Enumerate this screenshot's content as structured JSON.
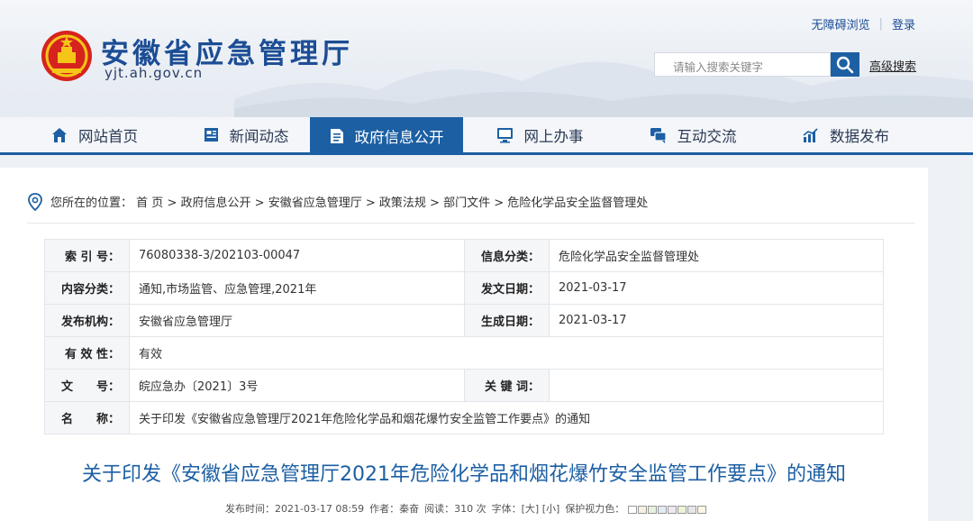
{
  "header": {
    "site_title": "安徽省应急管理厅",
    "site_domain": "yjt.ah.gov.cn",
    "accessibility_link": "无障碍浏览",
    "login_link": "登录",
    "search_placeholder": "请输入搜索关键字",
    "advanced_search": "高级搜索"
  },
  "nav": {
    "items": [
      {
        "label": "网站首页",
        "icon": "home-icon"
      },
      {
        "label": "新闻动态",
        "icon": "news-icon"
      },
      {
        "label": "政府信息公开",
        "icon": "document-icon",
        "active": true
      },
      {
        "label": "网上办事",
        "icon": "monitor-icon"
      },
      {
        "label": "互动交流",
        "icon": "chat-icon"
      },
      {
        "label": "数据发布",
        "icon": "chart-icon"
      }
    ]
  },
  "breadcrumb": {
    "prefix": "您所在的位置：",
    "items": [
      "首 页",
      "政府信息公开",
      "安徽省应急管理厅",
      "政策法规",
      "部门文件",
      "危险化学品安全监督管理处"
    ],
    "separator": ">"
  },
  "meta": {
    "index_label": "索 引 号：",
    "index_value": "76080338-3/202103-00047",
    "category_label": "信息分类：",
    "category_value": "危险化学品安全监督管理处",
    "content_label": "内容分类：",
    "content_value": "通知,市场监管、应急管理,2021年",
    "issue_date_label": "发文日期：",
    "issue_date_value": "2021-03-17",
    "org_label": "发布机构：",
    "org_value": "安徽省应急管理厅",
    "gen_date_label": "生成日期：",
    "gen_date_value": "2021-03-17",
    "validity_label": "有 效 性：",
    "validity_value": "有效",
    "docno_label": "文　　号：",
    "docno_value": "皖应急办〔2021〕3号",
    "keywords_label": "关 键 词：",
    "keywords_value": "",
    "name_label": "名　　称：",
    "name_value": "关于印发《安徽省应急管理厅2021年危险化学品和烟花爆竹安全监管工作要点》的通知"
  },
  "document": {
    "title": "关于印发《安徽省应急管理厅2021年危险化学品和烟花爆竹安全监管工作要点》的通知",
    "publish_time": "发布时间：2021-03-17 08:59",
    "author": "作者：秦奋",
    "views": "阅读：310 次",
    "font_size_label": "字体：",
    "font_large": "[大]",
    "font_small": "[小]",
    "eye_care_label": "保护视力色：",
    "eye_care_colors": [
      "#ffffff",
      "#f5f0e1",
      "#e8f0e0",
      "#e0ecf4",
      "#f0e8f0",
      "#eef3d8",
      "#e6e6e6",
      "#fdf6e3"
    ]
  },
  "colors": {
    "brand_blue": "#1c5fa3",
    "title_blue": "#1c4d95"
  }
}
